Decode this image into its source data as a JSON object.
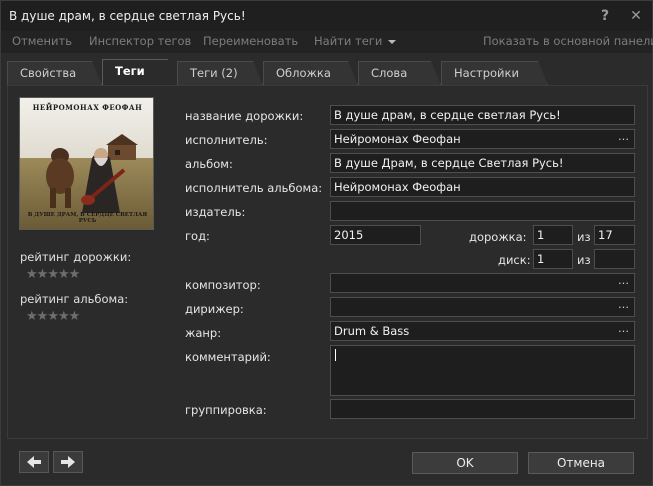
{
  "window": {
    "title": "В душе драм, в сердце светлая Русь!",
    "help_glyph": "?",
    "close_glyph": "✕"
  },
  "menu": {
    "undo": "Отменить",
    "inspector": "Инспектор тегов",
    "rename": "Переименовать",
    "find_tags": "Найти теги",
    "show_main": "Показать в основной панели"
  },
  "tabs": [
    "Свойства",
    "Теги",
    "Теги (2)",
    "Обложка",
    "Слова",
    "Настройки"
  ],
  "active_tab": "Теги",
  "cover": {
    "title": "НЕЙРОМОНАХ ФЕОФАН",
    "subtitle": "В ДУШЕ ДРАМ, В СЕРДЦЕ СВЕТЛАЯ РУСЬ"
  },
  "ratings": {
    "track_label": "рейтинг дорожки:",
    "album_label": "рейтинг альбома:",
    "track_stars": 0,
    "album_stars": 0,
    "max_stars": 5
  },
  "labels": {
    "track_title": "название дорожки:",
    "artist": "исполнитель:",
    "album": "альбом:",
    "album_artist": "исполнитель альбома:",
    "publisher": "издатель:",
    "year": "год:",
    "track": "дорожка:",
    "disc": "диск:",
    "of": "из",
    "composer": "композитор:",
    "conductor": "дирижер:",
    "genre": "жанр:",
    "comment": "комментарий:",
    "grouping": "группировка:"
  },
  "fields": {
    "track_title": "В душе драм, в сердце светлая Русь!",
    "artist": "Нейромонах Феофан",
    "album": "В душе Драм, в сердце Светлая Русь!",
    "album_artist": "Нейромонах Феофан",
    "publisher": "",
    "year": "2015",
    "track_no": "1",
    "track_total": "17",
    "disc_no": "1",
    "disc_total": "",
    "composer": "",
    "conductor": "",
    "genre": "Drum & Bass",
    "comment": "",
    "grouping": ""
  },
  "ellipsis": "…",
  "buttons": {
    "prev": "arrow-left-icon",
    "next": "arrow-right-icon",
    "ok": "OK",
    "cancel": "Отмена"
  }
}
